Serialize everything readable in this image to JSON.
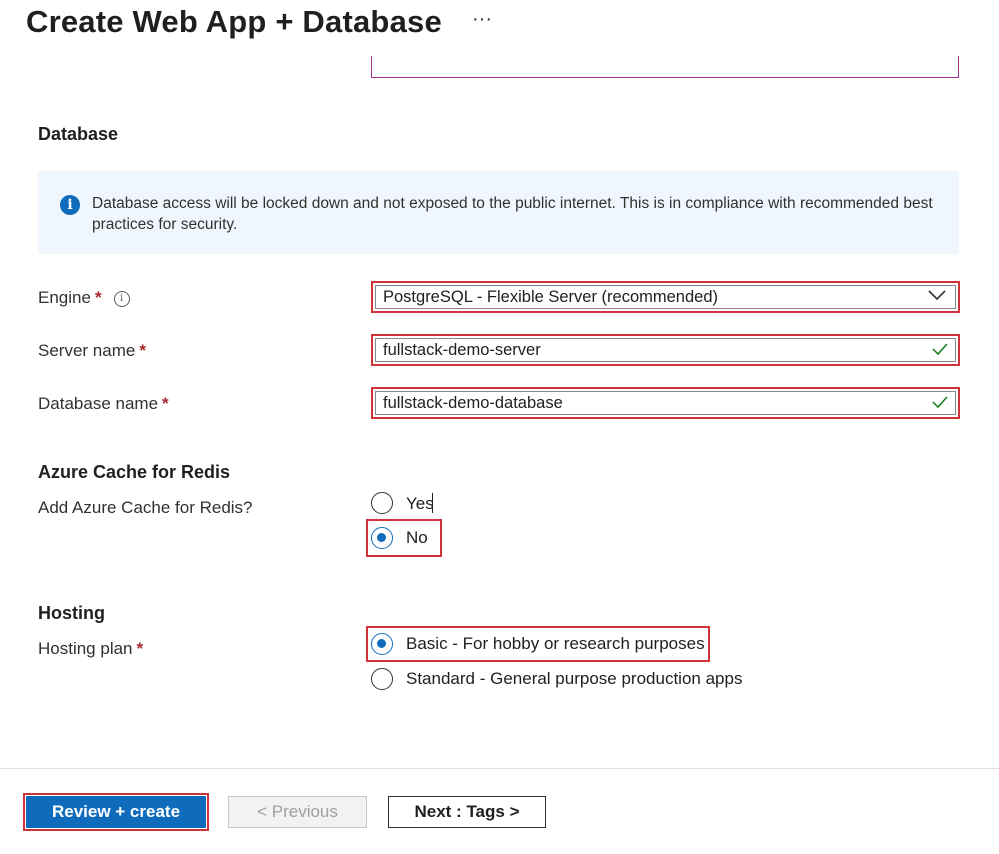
{
  "header": {
    "title": "Create Web App + Database",
    "more_label": "···"
  },
  "database_section": {
    "heading": "Database",
    "info_text": "Database access will be locked down and not exposed to the public internet. This is in compliance with recommended best practices for security.",
    "engine": {
      "label": "Engine",
      "required_mark": "*",
      "value": "PostgreSQL - Flexible Server (recommended)"
    },
    "server_name": {
      "label": "Server name",
      "required_mark": "*",
      "value": "fullstack-demo-server"
    },
    "database_name": {
      "label": "Database name",
      "required_mark": "*",
      "value": "fullstack-demo-database"
    }
  },
  "redis_section": {
    "heading": "Azure Cache for Redis",
    "question": "Add Azure Cache for Redis?",
    "options": [
      {
        "label": "Yes",
        "selected": false
      },
      {
        "label": "No",
        "selected": true
      }
    ]
  },
  "hosting_section": {
    "heading": "Hosting",
    "label": "Hosting plan",
    "required_mark": "*",
    "options": [
      {
        "label": "Basic - For hobby or research purposes",
        "selected": true
      },
      {
        "label": "Standard - General purpose production apps",
        "selected": false
      }
    ]
  },
  "footer": {
    "review_create": "Review + create",
    "previous": "< Previous",
    "next": "Next : Tags >"
  },
  "colors": {
    "accent": "#0f6cbd",
    "highlight": "#d13438",
    "required": "#a4262c",
    "info_bg": "#f0f6fd",
    "valid_check": "#107c10"
  }
}
